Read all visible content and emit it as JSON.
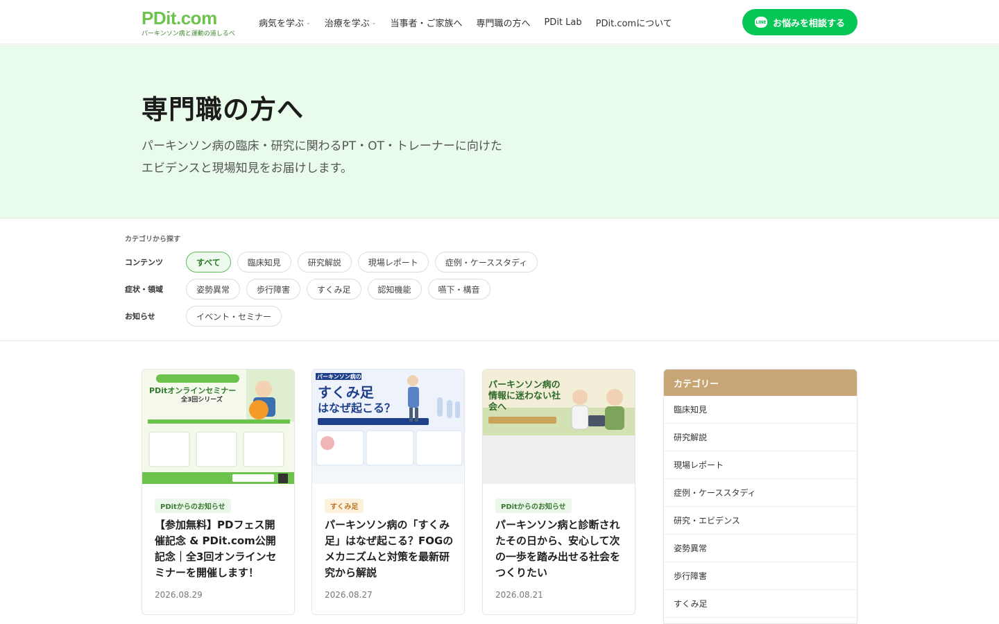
{
  "header": {
    "logo": "PDit.com",
    "logo_sub": "パーキンソン病と運動の道しるべ",
    "nav": [
      {
        "label": "病気を学ぶ",
        "dropdown": true
      },
      {
        "label": "治療を学ぶ",
        "dropdown": true
      },
      {
        "label": "当事者・ご家族へ",
        "dropdown": false
      },
      {
        "label": "専門職の方へ",
        "dropdown": false
      },
      {
        "label": "PDit Lab",
        "dropdown": false
      },
      {
        "label": "PDit.comについて",
        "dropdown": false
      }
    ],
    "cta_label": "お悩みを相談する",
    "cta_icon_text": "LINE"
  },
  "hero": {
    "title": "専門職の方へ",
    "desc_line1": "パーキンソン病の臨床・研究に関わるPT・OT・トレーナーに向けた",
    "desc_line2": "エビデンスと現場知見をお届けします。"
  },
  "filters": {
    "heading": "カテゴリから探す",
    "rows": [
      {
        "label": "コンテンツ",
        "chips": [
          "すべて",
          "臨床知見",
          "研究解説",
          "現場レポート",
          "症例・ケーススタディ"
        ]
      },
      {
        "label": "症状・領域",
        "chips": [
          "姿勢異常",
          "歩行障害",
          "すくみ足",
          "認知機能",
          "嚥下・構音"
        ]
      },
      {
        "label": "お知らせ",
        "chips": [
          "イベント・セミナー"
        ]
      }
    ],
    "active": "すべて"
  },
  "cards": [
    {
      "tag": "PDitからのお知らせ",
      "title": "【参加無料】PDフェス開催記念 & PDit.com公開記念｜全3回オンラインセミナーを開催します！",
      "date": "2026.08.29",
      "thumb_heading": "PDitオンラインセミナー",
      "thumb_sub": "全3回シリーズ"
    },
    {
      "tag": "すくみ足",
      "title": "パーキンソン病の「すくみ足」はなぜ起こる？FOGのメカニズムと対策を最新研究から解説",
      "date": "2026.08.27",
      "thumb_heading_small": "パーキンソン病の",
      "thumb_heading_big": "すくみ足",
      "thumb_heading_rest": "はなぜ起こる？"
    },
    {
      "tag": "PDitからのお知らせ",
      "title": "パーキンソン病と診断されたその日から、安心して次の一歩を踏み出せる社会をつくりたい",
      "date": "2026.08.21",
      "thumb_heading": "パーキンソン病の情報に迷わない社会へ"
    }
  ],
  "sidebar": {
    "heading": "カテゴリー",
    "items": [
      "臨床知見",
      "研究解説",
      "現場レポート",
      "症例・ケーススタディ",
      "研究・エビデンス",
      "姿勢異常",
      "歩行障害",
      "すくみ足",
      ""
    ]
  },
  "colors": {
    "brand_green": "#6cc24a",
    "line_green": "#06c755",
    "hero_bg": "#e9fbea",
    "sidebar_head": "#c8a574"
  }
}
